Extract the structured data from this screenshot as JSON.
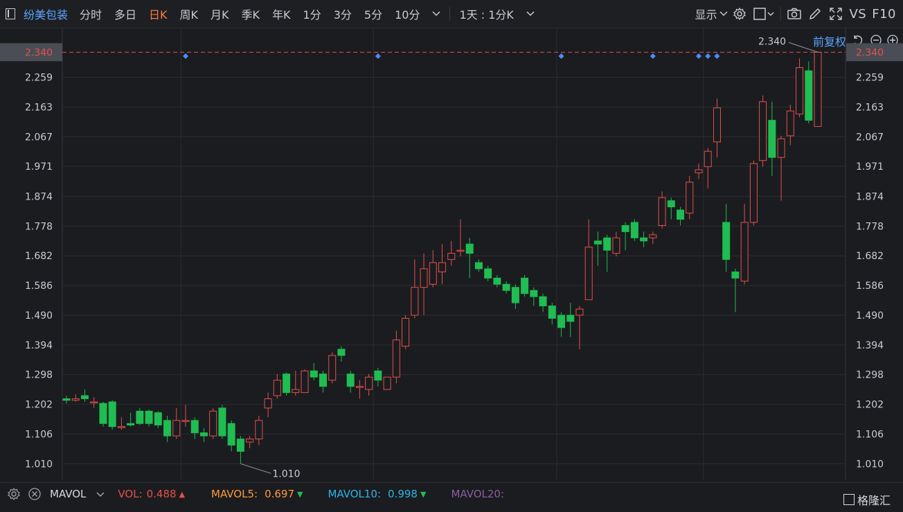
{
  "toolbar": {
    "stock_name": "纷美包装",
    "periods": [
      "分时",
      "多日",
      "日K",
      "周K",
      "月K",
      "季K",
      "年K",
      "1分",
      "3分",
      "5分",
      "10分"
    ],
    "active_period": "日K",
    "range_select": "1天 : 1分K",
    "display_menu": "显示",
    "vs_label": "VS",
    "f10_label": "F10"
  },
  "adjust_mode": "前复权",
  "colors": {
    "up": "#e5514c",
    "down": "#1fbd52",
    "accent": "#ff7a3c",
    "marker": "#4c8dff",
    "grid": "#2b2c31",
    "price_line": "#e5514c"
  },
  "chart_data": {
    "type": "candlestick",
    "ylim": [
      0.957,
      2.39
    ],
    "y_ticks": [
      "2.340",
      "2.259",
      "2.163",
      "2.067",
      "1.971",
      "1.874",
      "1.778",
      "1.682",
      "1.586",
      "1.490",
      "1.394",
      "1.298",
      "1.202",
      "1.106",
      "1.010"
    ],
    "current_price": "2.340",
    "high_label": "2.340",
    "low_label": "1.010",
    "event_markers": [
      13,
      34,
      54,
      64,
      69,
      70,
      71
    ],
    "candles": [
      [
        1.22,
        1.215,
        1.23,
        1.205
      ],
      [
        1.215,
        1.22,
        1.235,
        1.21
      ],
      [
        1.23,
        1.22,
        1.25,
        1.21
      ],
      [
        1.21,
        1.21,
        1.225,
        1.19
      ],
      [
        1.205,
        1.14,
        1.21,
        1.13
      ],
      [
        1.21,
        1.13,
        1.215,
        1.12
      ],
      [
        1.13,
        1.13,
        1.16,
        1.12
      ],
      [
        1.14,
        1.135,
        1.175,
        1.13
      ],
      [
        1.18,
        1.14,
        1.19,
        1.135
      ],
      [
        1.18,
        1.14,
        1.185,
        1.13
      ],
      [
        1.175,
        1.135,
        1.18,
        1.125
      ],
      [
        1.15,
        1.1,
        1.165,
        1.08
      ],
      [
        1.1,
        1.15,
        1.19,
        1.09
      ],
      [
        1.15,
        1.15,
        1.2,
        1.13
      ],
      [
        1.15,
        1.11,
        1.16,
        1.09
      ],
      [
        1.11,
        1.1,
        1.125,
        1.08
      ],
      [
        1.1,
        1.18,
        1.19,
        1.09
      ],
      [
        1.19,
        1.1,
        1.2,
        1.09
      ],
      [
        1.14,
        1.07,
        1.15,
        1.05
      ],
      [
        1.09,
        1.05,
        1.1,
        1.01
      ],
      [
        1.08,
        1.09,
        1.1,
        1.06
      ],
      [
        1.09,
        1.15,
        1.165,
        1.07
      ],
      [
        1.19,
        1.22,
        1.24,
        1.16
      ],
      [
        1.23,
        1.28,
        1.3,
        1.22
      ],
      [
        1.3,
        1.24,
        1.305,
        1.23
      ],
      [
        1.24,
        1.25,
        1.31,
        1.23
      ],
      [
        1.24,
        1.31,
        1.315,
        1.24
      ],
      [
        1.31,
        1.29,
        1.335,
        1.28
      ],
      [
        1.3,
        1.26,
        1.31,
        1.24
      ],
      [
        1.28,
        1.36,
        1.37,
        1.27
      ],
      [
        1.38,
        1.36,
        1.39,
        1.34
      ],
      [
        1.3,
        1.26,
        1.31,
        1.24
      ],
      [
        1.26,
        1.26,
        1.28,
        1.22
      ],
      [
        1.25,
        1.29,
        1.3,
        1.23
      ],
      [
        1.31,
        1.28,
        1.32,
        1.26
      ],
      [
        1.25,
        1.29,
        1.29,
        1.25
      ],
      [
        1.29,
        1.41,
        1.44,
        1.27
      ],
      [
        1.39,
        1.48,
        1.49,
        1.38
      ],
      [
        1.49,
        1.58,
        1.67,
        1.48
      ],
      [
        1.58,
        1.64,
        1.69,
        1.49
      ],
      [
        1.59,
        1.66,
        1.7,
        1.58
      ],
      [
        1.63,
        1.66,
        1.72,
        1.59
      ],
      [
        1.67,
        1.69,
        1.73,
        1.65
      ],
      [
        1.7,
        1.7,
        1.8,
        1.68
      ],
      [
        1.72,
        1.69,
        1.74,
        1.61
      ],
      [
        1.66,
        1.64,
        1.67,
        1.63
      ],
      [
        1.64,
        1.61,
        1.65,
        1.6
      ],
      [
        1.61,
        1.59,
        1.62,
        1.58
      ],
      [
        1.59,
        1.57,
        1.6,
        1.56
      ],
      [
        1.58,
        1.53,
        1.59,
        1.51
      ],
      [
        1.61,
        1.56,
        1.62,
        1.55
      ],
      [
        1.57,
        1.55,
        1.58,
        1.52
      ],
      [
        1.55,
        1.52,
        1.56,
        1.5
      ],
      [
        1.52,
        1.48,
        1.53,
        1.46
      ],
      [
        1.49,
        1.45,
        1.5,
        1.42
      ],
      [
        1.49,
        1.47,
        1.53,
        1.42
      ],
      [
        1.49,
        1.51,
        1.52,
        1.38
      ],
      [
        1.54,
        1.71,
        1.8,
        1.54
      ],
      [
        1.73,
        1.72,
        1.76,
        1.65
      ],
      [
        1.74,
        1.7,
        1.75,
        1.63
      ],
      [
        1.69,
        1.74,
        1.76,
        1.68
      ],
      [
        1.78,
        1.76,
        1.79,
        1.7
      ],
      [
        1.79,
        1.74,
        1.8,
        1.73
      ],
      [
        1.74,
        1.73,
        1.76,
        1.71
      ],
      [
        1.74,
        1.75,
        1.76,
        1.72
      ],
      [
        1.78,
        1.87,
        1.89,
        1.77
      ],
      [
        1.86,
        1.84,
        1.87,
        1.8
      ],
      [
        1.83,
        1.8,
        1.84,
        1.78
      ],
      [
        1.82,
        1.92,
        1.94,
        1.8
      ],
      [
        1.95,
        1.96,
        1.98,
        1.93
      ],
      [
        1.97,
        2.02,
        2.03,
        1.9
      ],
      [
        2.05,
        2.16,
        2.19,
        2.0
      ],
      [
        1.79,
        1.67,
        1.85,
        1.63
      ],
      [
        1.63,
        1.61,
        1.64,
        1.5
      ],
      [
        1.6,
        1.79,
        1.85,
        1.59
      ],
      [
        1.79,
        1.98,
        1.99,
        1.78
      ],
      [
        1.99,
        2.18,
        2.2,
        1.97
      ],
      [
        2.12,
        2.0,
        2.18,
        1.94
      ],
      [
        2.0,
        2.06,
        2.07,
        1.86
      ],
      [
        2.07,
        2.15,
        2.17,
        2.04
      ],
      [
        2.14,
        2.29,
        2.32,
        2.13
      ],
      [
        2.28,
        2.12,
        2.31,
        2.11
      ],
      [
        2.1,
        2.34,
        2.34,
        2.1
      ]
    ]
  },
  "volume_bar": {
    "label": "MAVOL",
    "vol_label": "VOL:",
    "vol_value": "0.488",
    "mavol5_label": "MAVOL5:",
    "mavol5_value": "0.697",
    "mavol10_label": "MAVOL10:",
    "mavol10_value": "0.998",
    "mavol20_label": "MAVOL20:"
  },
  "watermark": "格隆汇"
}
